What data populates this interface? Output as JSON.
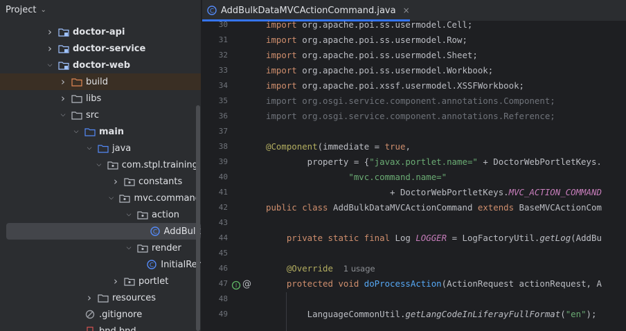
{
  "project_pane": {
    "title": "Project",
    "tree": [
      {
        "label": "doctor-api",
        "depth": 0,
        "arrow": "right",
        "icon": "module-folder-icon",
        "bold": true
      },
      {
        "label": "doctor-service",
        "depth": 0,
        "arrow": "right",
        "icon": "module-folder-icon",
        "bold": true
      },
      {
        "label": "doctor-web",
        "depth": 0,
        "arrow": "down",
        "icon": "module-folder-icon",
        "bold": true
      },
      {
        "label": "build",
        "depth": 1,
        "arrow": "right",
        "icon": "excluded-folder-icon",
        "bold": false,
        "highlight": "build"
      },
      {
        "label": "libs",
        "depth": 1,
        "arrow": "right",
        "icon": "folder-icon",
        "bold": false
      },
      {
        "label": "src",
        "depth": 1,
        "arrow": "down",
        "icon": "folder-icon",
        "bold": false
      },
      {
        "label": "main",
        "depth": 2,
        "arrow": "down",
        "icon": "source-folder-icon",
        "bold": true
      },
      {
        "label": "java",
        "depth": 3,
        "arrow": "down",
        "icon": "source-folder-icon",
        "bold": false
      },
      {
        "label": "com.stpl.training.",
        "depth": 4,
        "arrow": "down",
        "icon": "package-icon",
        "bold": false
      },
      {
        "label": "constants",
        "depth": 5,
        "arrow": "right",
        "icon": "package-icon",
        "bold": false
      },
      {
        "label": "mvc.command",
        "depth": 5,
        "arrow": "down",
        "icon": "package-icon",
        "bold": false
      },
      {
        "label": "action",
        "depth": 6,
        "arrow": "down",
        "icon": "package-icon",
        "bold": false
      },
      {
        "label": "AddBulk",
        "depth": 7,
        "arrow": "",
        "icon": "java-class-icon",
        "bold": false,
        "highlight": "selected"
      },
      {
        "label": "render",
        "depth": 6,
        "arrow": "down",
        "icon": "package-icon",
        "bold": false
      },
      {
        "label": "InitialRer",
        "depth": 7,
        "arrow": "",
        "icon": "java-class-icon",
        "bold": false
      },
      {
        "label": "portlet",
        "depth": 5,
        "arrow": "right",
        "icon": "package-icon",
        "bold": false
      },
      {
        "label": "resources",
        "depth": 3,
        "arrow": "right",
        "icon": "resources-folder-icon",
        "bold": false
      },
      {
        "label": ".gitignore",
        "depth": 2,
        "arrow": "",
        "icon": "gitignore-icon",
        "bold": false
      },
      {
        "label": "bnd.bnd",
        "depth": 2,
        "arrow": "",
        "icon": "file-icon",
        "bold": false
      }
    ]
  },
  "editor": {
    "tab": {
      "label": "AddBulkDataMVCActionCommand.java",
      "close": "×",
      "icon": "java-class-icon"
    },
    "lines": [
      {
        "n": "30",
        "parts": [
          [
            "kw",
            "import "
          ],
          [
            "pkg",
            "org.apache.poi.ss.usermodel.Cell;"
          ]
        ]
      },
      {
        "n": "31",
        "parts": [
          [
            "kw",
            "import "
          ],
          [
            "pkg",
            "org.apache.poi.ss.usermodel.Row;"
          ]
        ]
      },
      {
        "n": "32",
        "parts": [
          [
            "kw",
            "import "
          ],
          [
            "pkg",
            "org.apache.poi.ss.usermodel.Sheet;"
          ]
        ]
      },
      {
        "n": "33",
        "parts": [
          [
            "kw",
            "import "
          ],
          [
            "pkg",
            "org.apache.poi.ss.usermodel.Workbook;"
          ]
        ]
      },
      {
        "n": "34",
        "parts": [
          [
            "kw",
            "import "
          ],
          [
            "pkg",
            "org.apache.poi.xssf.usermodel.XSSFWorkbook;"
          ]
        ]
      },
      {
        "n": "35",
        "parts": [
          [
            "dim",
            "import org.osgi.service.component.annotations.Component;"
          ]
        ]
      },
      {
        "n": "36",
        "parts": [
          [
            "dim",
            "import org.osgi.service.component.annotations.Reference;"
          ]
        ]
      },
      {
        "n": "37",
        "parts": []
      },
      {
        "n": "38",
        "parts": [
          [
            "ann",
            "@Component"
          ],
          [
            "pkg",
            "(immediate = "
          ],
          [
            "kw",
            "true"
          ],
          [
            "pkg",
            ","
          ]
        ]
      },
      {
        "n": "39",
        "parts": [
          [
            "pkg",
            "        property = {"
          ],
          [
            "str",
            "\"javax.portlet.name=\""
          ],
          [
            "pkg",
            " + DoctorWebPortletKeys."
          ]
        ]
      },
      {
        "n": "40",
        "parts": [
          [
            "pkg",
            "                "
          ],
          [
            "str",
            "\"mvc.command.name=\""
          ]
        ]
      },
      {
        "n": "41",
        "parts": [
          [
            "pkg",
            "                        + DoctorWebPortletKeys."
          ],
          [
            "const",
            "MVC_ACTION_COMMAND"
          ]
        ]
      },
      {
        "n": "42",
        "parts": [
          [
            "kw",
            "public class "
          ],
          [
            "pkg",
            "AddBulkDataMVCActionCommand "
          ],
          [
            "kw",
            "extends "
          ],
          [
            "pkg",
            "BaseMVCActionCom"
          ]
        ]
      },
      {
        "n": "43",
        "parts": []
      },
      {
        "n": "44",
        "parts": [
          [
            "pkg",
            "    "
          ],
          [
            "kw",
            "private static final "
          ],
          [
            "pkg",
            "Log "
          ],
          [
            "const",
            "LOGGER"
          ],
          [
            "pkg",
            " = LogFactoryUtil."
          ],
          [
            "it",
            "getLog"
          ],
          [
            "pkg",
            "(AddBu"
          ]
        ]
      },
      {
        "n": "45",
        "parts": []
      },
      {
        "n": "46",
        "parts": [
          [
            "pkg",
            "    "
          ],
          [
            "ann",
            "@Override"
          ],
          [
            "pkg",
            "  "
          ],
          [
            "hint",
            "1 usage"
          ]
        ]
      },
      {
        "n": "47",
        "parts": [
          [
            "pkg",
            "    "
          ],
          [
            "kw",
            "protected void "
          ],
          [
            "fn",
            "doProcessAction"
          ],
          [
            "pkg",
            "(ActionRequest actionRequest, A"
          ]
        ]
      },
      {
        "n": "48",
        "parts": []
      },
      {
        "n": "49",
        "parts": [
          [
            "pkg",
            "        LanguageCommonUtil."
          ],
          [
            "it",
            "getLangCodeInLiferayFullFormat"
          ],
          [
            "pkg",
            "("
          ],
          [
            "str",
            "\"en\""
          ],
          [
            "pkg",
            ");"
          ]
        ]
      }
    ]
  },
  "colors": {
    "accent": "#3574f0",
    "selection": "#43454a",
    "build_highlight": "#3a2f24"
  }
}
